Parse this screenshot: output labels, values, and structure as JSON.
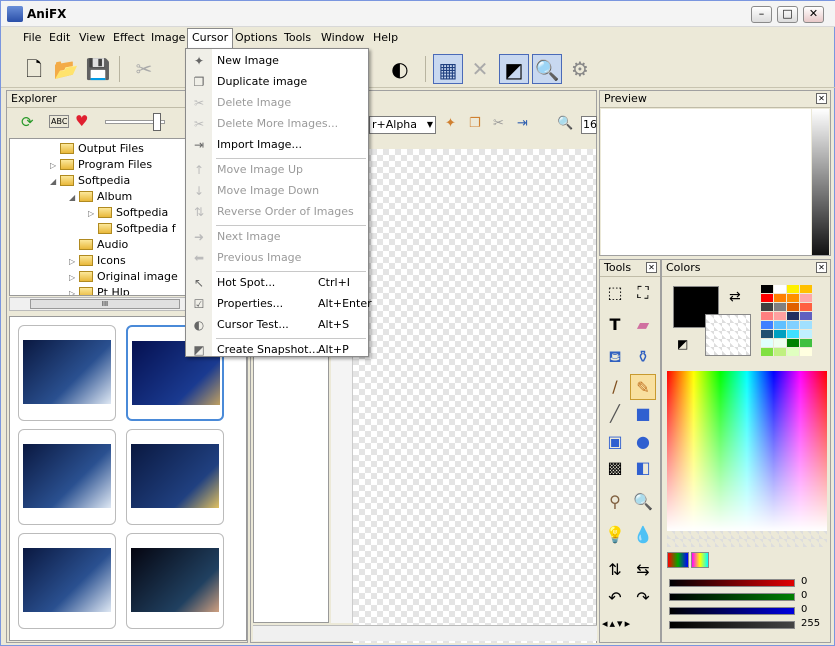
{
  "window": {
    "title": "AniFX",
    "min": "–",
    "max": "□",
    "close": "✕"
  },
  "menu": [
    "File",
    "Edit",
    "View",
    "Effect",
    "Image",
    "Cursor",
    "Options",
    "Tools",
    "Window",
    "Help"
  ],
  "explorer": {
    "title": "Explorer",
    "tree": [
      {
        "label": "Output Files",
        "indent": 1,
        "expander": ""
      },
      {
        "label": "Program Files",
        "indent": 1,
        "expander": "▷"
      },
      {
        "label": "Softpedia",
        "indent": 1,
        "expander": "◢"
      },
      {
        "label": "Album",
        "indent": 2,
        "expander": "◢"
      },
      {
        "label": "Softpedia",
        "indent": 3,
        "expander": "▷"
      },
      {
        "label": "Softpedia f",
        "indent": 3,
        "expander": ""
      },
      {
        "label": "Audio",
        "indent": 2,
        "expander": ""
      },
      {
        "label": "Icons",
        "indent": 2,
        "expander": "▷"
      },
      {
        "label": "Original image",
        "indent": 2,
        "expander": "▷"
      },
      {
        "label": "Pt Hlp",
        "indent": 2,
        "expander": "▷"
      }
    ],
    "scroll_thumb": "III"
  },
  "editor": {
    "combo_value": "r+Alpha",
    "zoom_value": "16"
  },
  "preview": {
    "title": "Preview"
  },
  "tools": {
    "title": "Tools"
  },
  "colors": {
    "title": "Colors",
    "sliders": [
      {
        "name": "red",
        "value": "0",
        "color": "#e00000"
      },
      {
        "name": "green",
        "value": "0",
        "color": "#008000"
      },
      {
        "name": "blue",
        "value": "0",
        "color": "#0000e0"
      },
      {
        "name": "alpha",
        "value": "255",
        "color": "#444444"
      }
    ]
  },
  "cursor_menu": [
    {
      "label": "New Image",
      "shortcut": "",
      "enabled": true,
      "icon": "new-image-icon",
      "glyph": "✦"
    },
    {
      "label": "Duplicate image",
      "shortcut": "",
      "enabled": true,
      "icon": "duplicate-image-icon",
      "glyph": "❐"
    },
    {
      "label": "Delete Image",
      "shortcut": "",
      "enabled": false,
      "icon": "delete-image-icon",
      "glyph": "✂"
    },
    {
      "label": "Delete More Images...",
      "shortcut": "",
      "enabled": false,
      "icon": "delete-more-images-icon",
      "glyph": "✂"
    },
    {
      "label": "Import Image...",
      "shortcut": "",
      "enabled": true,
      "icon": "import-image-icon",
      "glyph": "⇥"
    },
    {
      "sep": true
    },
    {
      "label": "Move Image Up",
      "shortcut": "",
      "enabled": false,
      "icon": "move-up-icon",
      "glyph": "↑"
    },
    {
      "label": "Move Image Down",
      "shortcut": "",
      "enabled": false,
      "icon": "move-down-icon",
      "glyph": "↓"
    },
    {
      "label": "Reverse Order of Images",
      "shortcut": "",
      "enabled": false,
      "icon": "reverse-order-icon",
      "glyph": "⇅"
    },
    {
      "sep": true
    },
    {
      "label": "Next Image",
      "shortcut": "",
      "enabled": false,
      "icon": "next-image-icon",
      "glyph": "➜"
    },
    {
      "label": "Previous Image",
      "shortcut": "",
      "enabled": false,
      "icon": "previous-image-icon",
      "glyph": "⬅"
    },
    {
      "sep": true
    },
    {
      "label": "Hot Spot...",
      "shortcut": "Ctrl+I",
      "enabled": true,
      "icon": "hot-spot-icon",
      "glyph": "↖"
    },
    {
      "label": "Properties...",
      "shortcut": "Alt+Enter",
      "enabled": true,
      "icon": "properties-icon",
      "glyph": "☑"
    },
    {
      "label": "Cursor Test...",
      "shortcut": "Alt+S",
      "enabled": true,
      "icon": "cursor-test-icon",
      "glyph": "◐"
    },
    {
      "sep": true
    },
    {
      "label": "Create Snapshot...",
      "shortcut": "Alt+P",
      "enabled": true,
      "icon": "snapshot-icon",
      "glyph": "◩"
    }
  ],
  "palette": [
    "#000000",
    "#ffffff",
    "#fff000",
    "#ffc000",
    "#ff0000",
    "#ff8000",
    "#ff9000",
    "#ffa8a8",
    "#404040",
    "#808080",
    "#e06000",
    "#ff6040",
    "#ff8080",
    "#ffa0a0",
    "#203060",
    "#6060c0",
    "#4080ff",
    "#60c0ff",
    "#80d0ff",
    "#a0e0ff",
    "#205070",
    "#00a0c0",
    "#40e0ff",
    "#c0f0ff",
    "#e0ffff",
    "#f0fff0",
    "#008000",
    "#40c040",
    "#80e040",
    "#c0f080",
    "#e0ffc0",
    "#ffffe0"
  ]
}
